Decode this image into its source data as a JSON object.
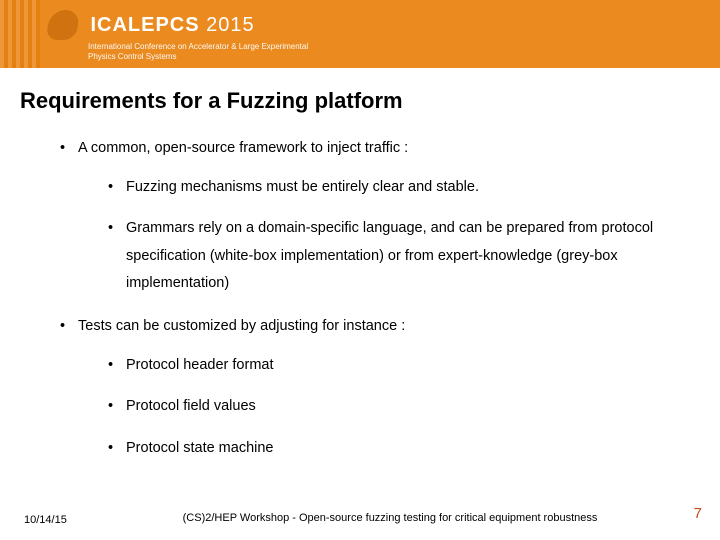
{
  "banner": {
    "conference": "ICALEPCS",
    "year": "2015",
    "subtitle": "International Conference on Accelerator & Large Experimental Physics Control Systems"
  },
  "title": "Requirements for a Fuzzing platform",
  "bullets": [
    {
      "text": "A common, open-source framework to inject traffic :",
      "children": [
        "Fuzzing mechanisms must be entirely clear and stable.",
        "Grammars rely on a domain-specific language, and can be prepared from protocol specification (white-box implementation) or from expert-knowledge (grey-box implementation)"
      ]
    },
    {
      "text": "Tests can be customized by adjusting for instance :",
      "children": [
        "Protocol header format",
        "Protocol field values",
        "Protocol state machine"
      ]
    }
  ],
  "footer": {
    "date": "10/14/15",
    "text": "(CS)2/HEP Workshop - Open-source fuzzing testing for critical equipment robustness",
    "page": "7"
  }
}
